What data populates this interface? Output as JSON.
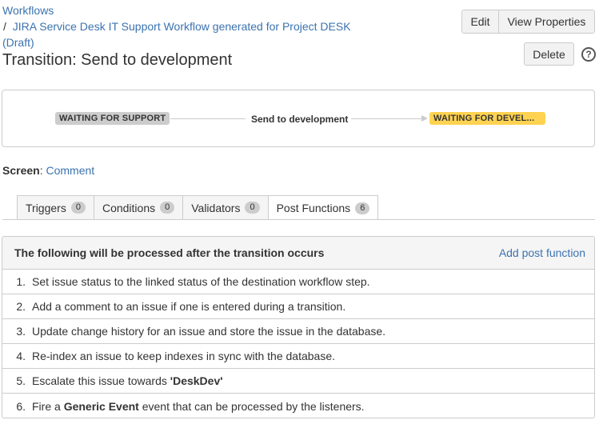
{
  "breadcrumb": {
    "root": "Workflows",
    "separator": "/",
    "workflow": "JIRA Service Desk IT Support Workflow generated for Project DESK (Draft)"
  },
  "page": {
    "title": "Transition: Send to development"
  },
  "actions": {
    "edit": "Edit",
    "view_properties": "View Properties",
    "delete": "Delete",
    "help_glyph": "?"
  },
  "diagram": {
    "from_status": "WAITING FOR SUPPORT",
    "transition": "Send to development",
    "to_status": "WAITING FOR DEVEL...",
    "colors": {
      "from": "#cccccc",
      "to": "#ffd351"
    }
  },
  "screen": {
    "label": "Screen",
    "value": "Comment"
  },
  "tabs": [
    {
      "label": "Triggers",
      "count": "0"
    },
    {
      "label": "Conditions",
      "count": "0"
    },
    {
      "label": "Validators",
      "count": "0"
    },
    {
      "label": "Post Functions",
      "count": "6"
    }
  ],
  "post_functions": {
    "heading": "The following will be processed after the transition occurs",
    "add_link": "Add post function",
    "items": [
      {
        "num": "1.",
        "text": "Set issue status to the linked status of the destination workflow step."
      },
      {
        "num": "2.",
        "text": "Add a comment to an issue if one is entered during a transition."
      },
      {
        "num": "3.",
        "text": "Update change history for an issue and store the issue in the database."
      },
      {
        "num": "4.",
        "text": "Re-index an issue to keep indexes in sync with the database."
      },
      {
        "num": "5.",
        "pre": "Escalate this issue towards ",
        "bold": "'DeskDev'",
        "post": ""
      },
      {
        "num": "6.",
        "pre": "Fire a ",
        "bold": "Generic Event",
        "post": " event that can be processed by the listeners."
      }
    ]
  }
}
